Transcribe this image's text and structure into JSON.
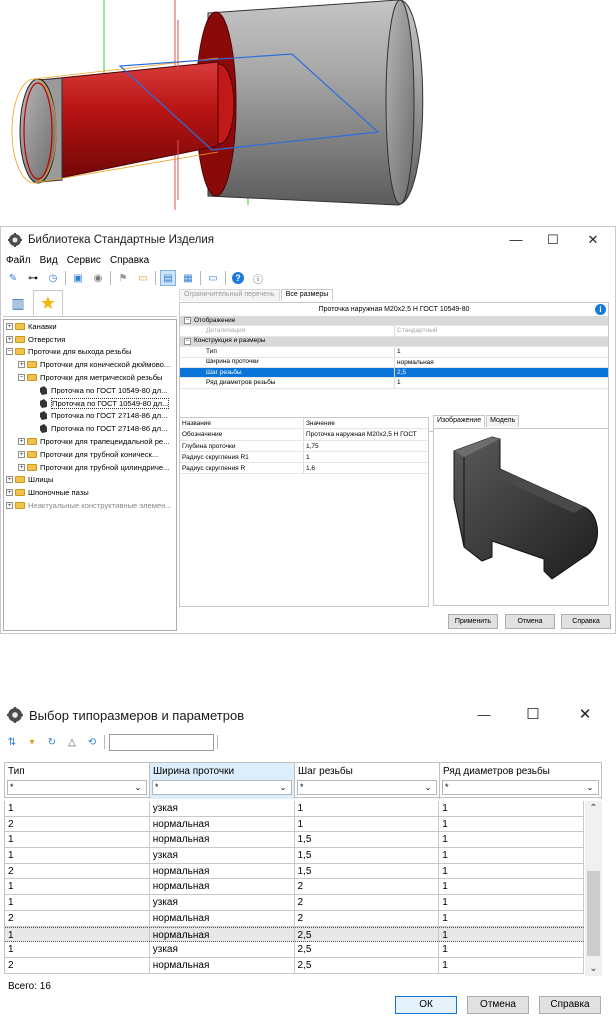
{
  "window1": {
    "title": "Библиотека Стандартные Изделия",
    "controls": {
      "minimize": "—",
      "maximize": "☐",
      "close": "✕"
    },
    "menu": [
      "Файл",
      "Вид",
      "Сервис",
      "Справка"
    ],
    "tree": [
      {
        "label": "Канавки",
        "level": 0,
        "exp": "+",
        "type": "folder"
      },
      {
        "label": "Отверстия",
        "level": 0,
        "exp": "+",
        "type": "folder"
      },
      {
        "label": "Проточки для выхода резьбы",
        "level": 0,
        "exp": "−",
        "type": "folder"
      },
      {
        "label": "Проточки для конической дюймово...",
        "level": 1,
        "exp": "+",
        "type": "folder"
      },
      {
        "label": "Проточки для метрической резьбы",
        "level": 1,
        "exp": "−",
        "type": "folder"
      },
      {
        "label": "Проточка по ГОСТ 10549-80 дл...",
        "level": 2,
        "exp": "",
        "type": "doc"
      },
      {
        "label": "Проточка по ГОСТ 10549-80 дл...",
        "level": 2,
        "exp": "",
        "type": "doc",
        "selected": true
      },
      {
        "label": "Проточка по ГОСТ 27148-86 дл...",
        "level": 2,
        "exp": "",
        "type": "doc"
      },
      {
        "label": "Проточка по ГОСТ 27148-86 дл...",
        "level": 2,
        "exp": "",
        "type": "doc"
      },
      {
        "label": "Проточки для трапецеидальной ре...",
        "level": 1,
        "exp": "+",
        "type": "folder"
      },
      {
        "label": "Проточки для трубной коническ...",
        "level": 1,
        "exp": "+",
        "type": "folder"
      },
      {
        "label": "Проточки для трубной цилиндриче...",
        "level": 1,
        "exp": "+",
        "type": "folder"
      },
      {
        "label": "Шлицы",
        "level": 0,
        "exp": "+",
        "type": "folder"
      },
      {
        "label": "Шпоночные пазы",
        "level": 0,
        "exp": "+",
        "type": "folder"
      },
      {
        "label": "Неактуальные конструктивные элемен...",
        "level": 0,
        "exp": "+",
        "type": "folder",
        "grey": true
      }
    ],
    "tabs": {
      "restricted": "Ограничительный перечень",
      "all_sizes": "Все размеры"
    },
    "params_header": "Проточка наружная М20х2,5 Н ГОСТ 10549-80",
    "params": [
      {
        "label": "Отображение",
        "value": "",
        "group": true,
        "exp": "−"
      },
      {
        "label": "Детализация",
        "value": "Стандартный",
        "grey": true
      },
      {
        "label": "Конструкция и размеры",
        "value": "",
        "group": true,
        "exp": "−"
      },
      {
        "label": "Тип",
        "value": "1"
      },
      {
        "label": "Ширина проточки",
        "value": "нормальная"
      },
      {
        "label": "Шаг резьбы",
        "value": "2,5",
        "highlight": true
      },
      {
        "label": "Ряд диаметров резьбы",
        "value": "1"
      }
    ],
    "props_header": {
      "name": "Название",
      "value": "Значение"
    },
    "props": [
      {
        "name": "Обозначение",
        "value": "Проточка наружная М20х2,5 Н ГОСТ"
      },
      {
        "name": "Глубина проточки",
        "value": "1,75"
      },
      {
        "name": "Радиус скругления R1",
        "value": "1"
      },
      {
        "name": "Радиус скругления R",
        "value": "1,6"
      }
    ],
    "image_tabs": {
      "image": "Изображение",
      "model": "Модель"
    },
    "buttons": {
      "apply": "Применить",
      "cancel": "Отмена",
      "help": "Справка"
    }
  },
  "window2": {
    "title": "Выбор типоразмеров и параметров",
    "controls": {
      "minimize": "—",
      "maximize": "☐",
      "close": "✕"
    },
    "search_value": "",
    "columns": [
      {
        "label": "Тип",
        "filter": "*"
      },
      {
        "label": "Ширина проточки",
        "filter": "*"
      },
      {
        "label": "Шаг резьбы",
        "filter": "*"
      },
      {
        "label": "Ряд диаметров резьбы",
        "filter": "*"
      }
    ],
    "rows": [
      [
        "1",
        "узкая",
        "1",
        "1"
      ],
      [
        "2",
        "нормальная",
        "1",
        "1"
      ],
      [
        "1",
        "нормальная",
        "1,5",
        "1"
      ],
      [
        "1",
        "узкая",
        "1,5",
        "1"
      ],
      [
        "2",
        "нормальная",
        "1,5",
        "1"
      ],
      [
        "1",
        "нормальная",
        "2",
        "1"
      ],
      [
        "1",
        "узкая",
        "2",
        "1"
      ],
      [
        "2",
        "нормальная",
        "2",
        "1"
      ],
      [
        "1",
        "нормальная",
        "2,5",
        "1"
      ],
      [
        "1",
        "узкая",
        "2,5",
        "1"
      ],
      [
        "2",
        "нормальная",
        "2,5",
        "1"
      ]
    ],
    "selected_row": 8,
    "total": "Всего: 16",
    "buttons": {
      "ok": "ОК",
      "cancel": "Отмена",
      "help": "Справка"
    }
  },
  "colors": {
    "accent": "#0a74d8",
    "model_red": "#c8141a",
    "model_grey": "#8c8c8c"
  }
}
